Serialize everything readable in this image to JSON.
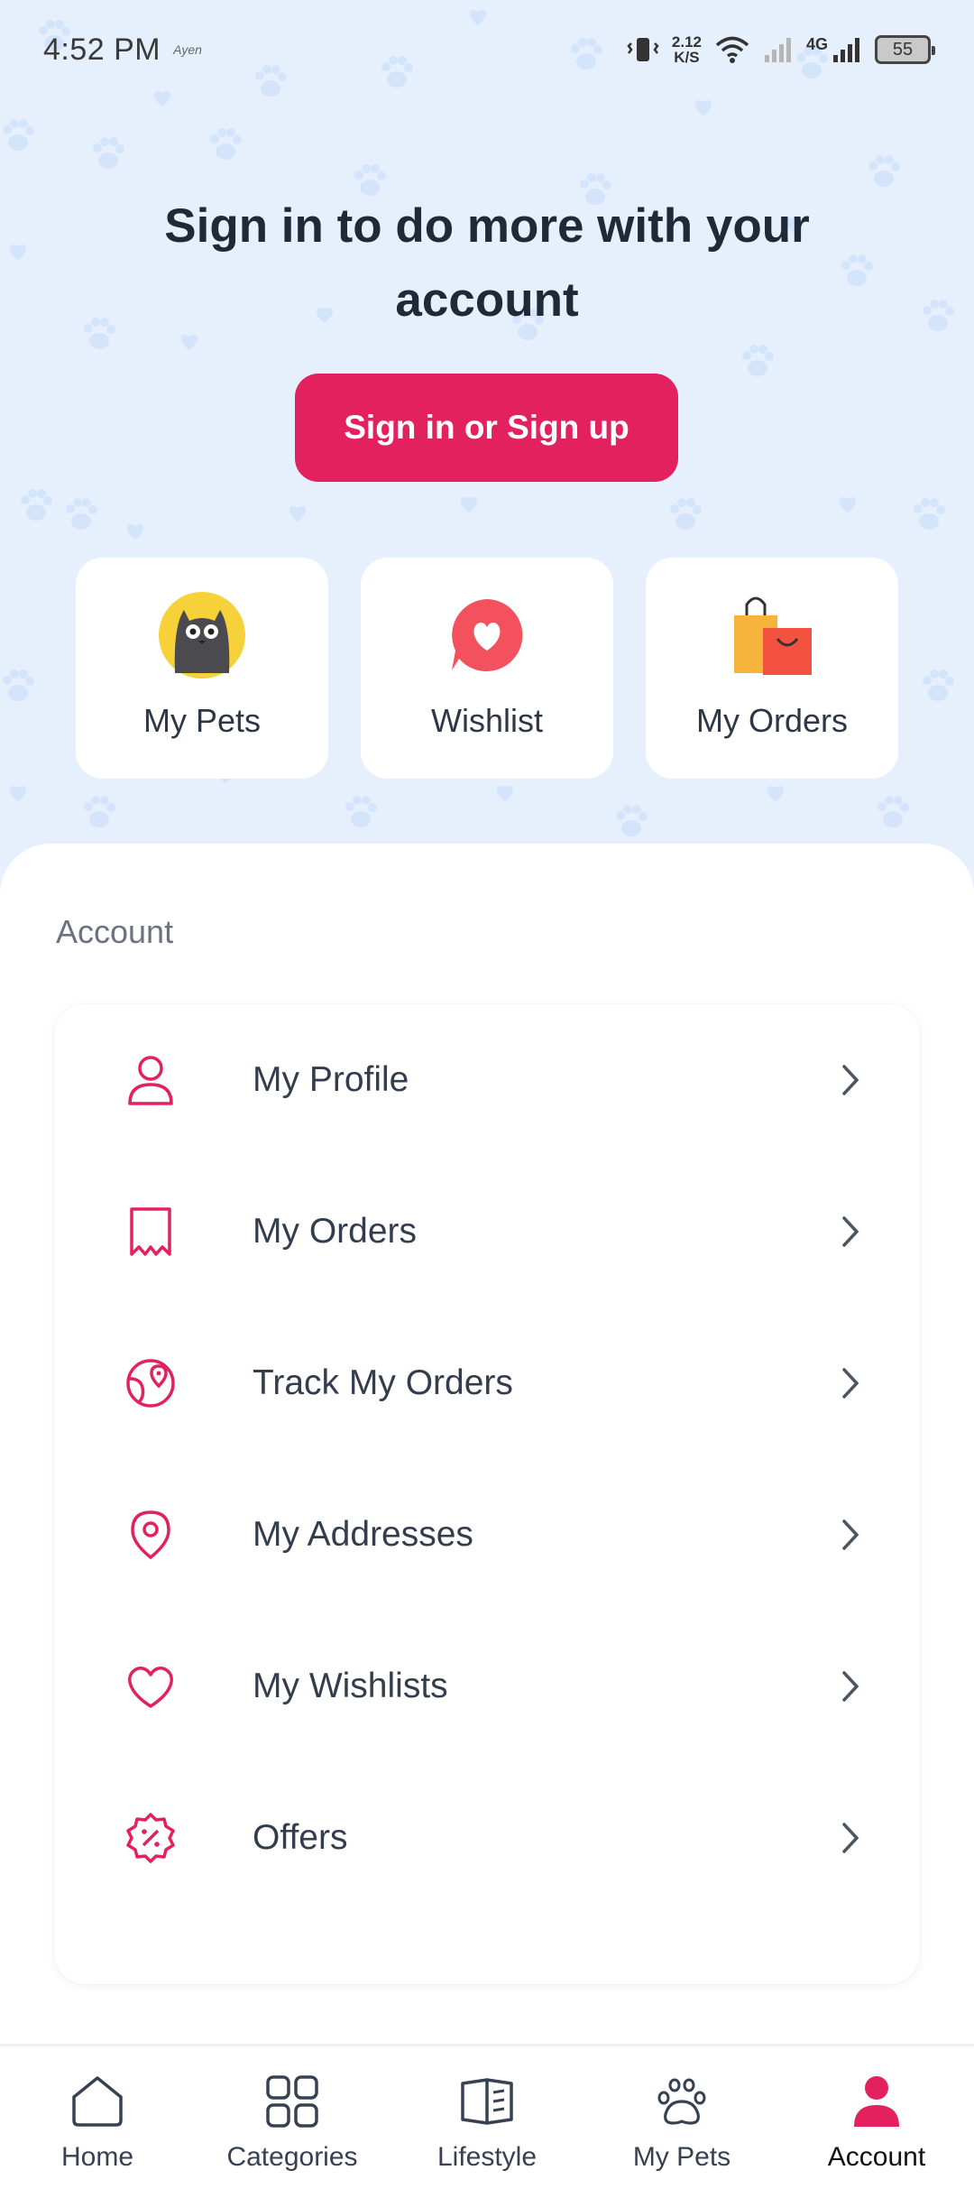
{
  "status_bar": {
    "time": "4:52 PM",
    "small_text": "Ayen",
    "speed_value": "2.12",
    "speed_unit": "K/S",
    "network": "4G",
    "battery": "55"
  },
  "hero": {
    "title": "Sign in to do more with your account",
    "signin_button": "Sign in or Sign up"
  },
  "quick_links": [
    {
      "label": "My Pets",
      "icon": "cat-icon"
    },
    {
      "label": "Wishlist",
      "icon": "heart-bubble-icon"
    },
    {
      "label": "My Orders",
      "icon": "shopping-bags-icon"
    }
  ],
  "account": {
    "section_title": "Account",
    "items": [
      {
        "label": "My Profile",
        "icon": "user-icon"
      },
      {
        "label": "My Orders",
        "icon": "receipt-icon"
      },
      {
        "label": "Track My Orders",
        "icon": "globe-pin-icon"
      },
      {
        "label": "My Addresses",
        "icon": "location-pin-icon"
      },
      {
        "label": "My Wishlists",
        "icon": "heart-icon"
      },
      {
        "label": "Offers",
        "icon": "discount-badge-icon"
      }
    ]
  },
  "bottom_nav": {
    "items": [
      {
        "label": "Home",
        "icon": "home-icon"
      },
      {
        "label": "Categories",
        "icon": "grid-icon"
      },
      {
        "label": "Lifestyle",
        "icon": "book-icon"
      },
      {
        "label": "My Pets",
        "icon": "paw-icon"
      },
      {
        "label": "Account",
        "icon": "account-icon"
      }
    ],
    "active": "Account"
  },
  "colors": {
    "accent": "#e3215e",
    "hero_background": "#e6f0fd",
    "text_dark": "#1f2937"
  }
}
